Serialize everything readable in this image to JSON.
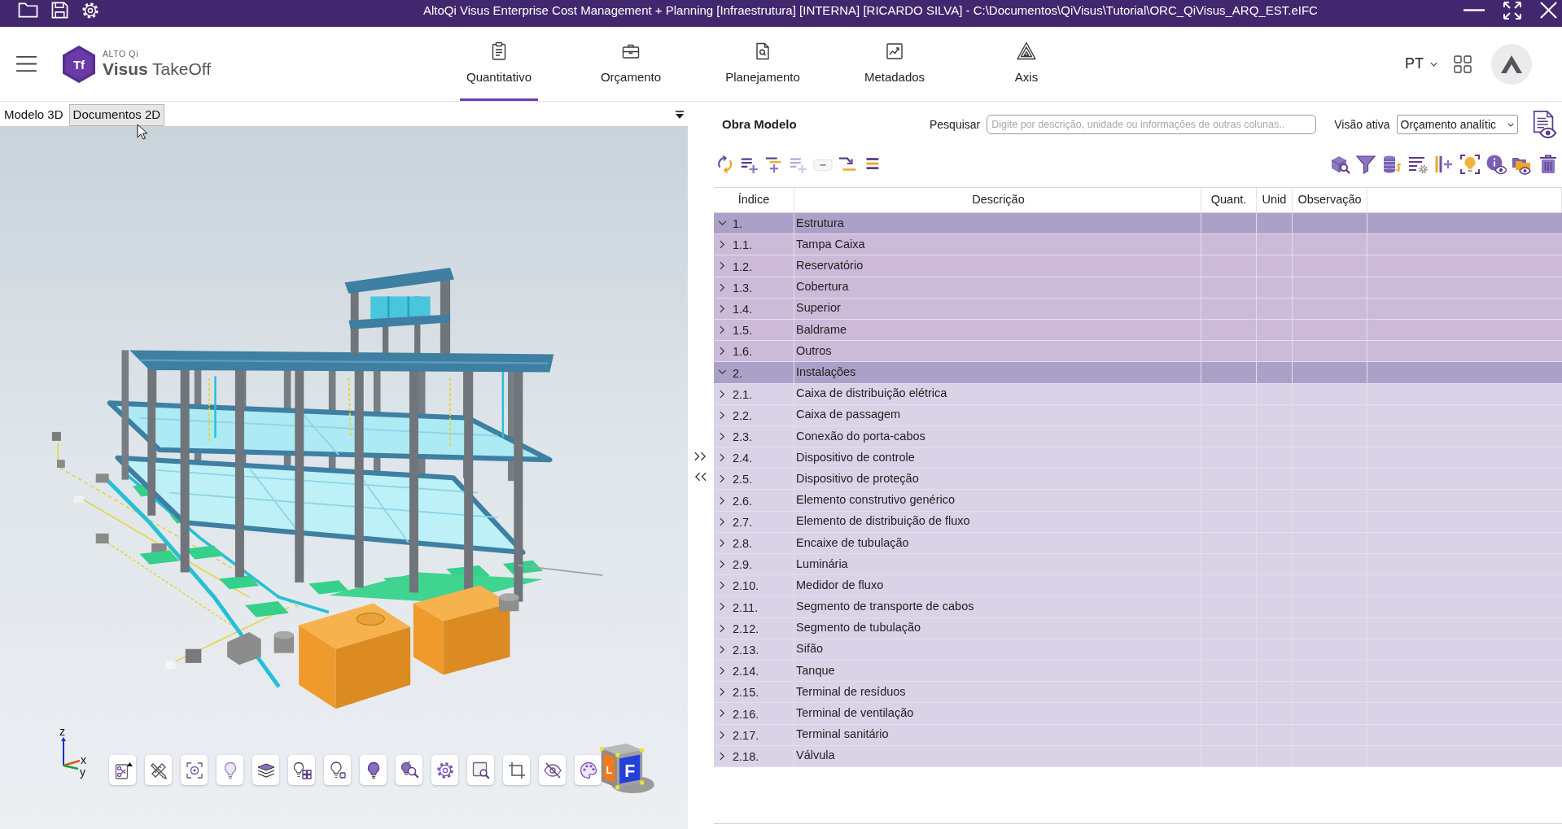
{
  "window": {
    "title": "AltoQi Visus Enterprise Cost Management + Planning [Infraestrutura] [INTERNA] [RICARDO SILVA] - C:\\Documentos\\QiVisus\\Tutorial\\ORC_QiVisus_ARQ_EST.eIFC"
  },
  "logo": {
    "mark": "Tf",
    "brand": "ALTO Qi",
    "product": "**Visus** TakeOff"
  },
  "nav_tabs": [
    {
      "label": "Quantitativo",
      "selected": true
    },
    {
      "label": "Orçamento",
      "selected": false
    },
    {
      "label": "Planejamento",
      "selected": false
    },
    {
      "label": "Metadados",
      "selected": false
    },
    {
      "label": "Axis",
      "selected": false
    }
  ],
  "language": "PT",
  "view_tabs": [
    {
      "label": "Modelo 3D",
      "selected": true
    },
    {
      "label": "Documentos 2D",
      "selected": false
    }
  ],
  "viewer": {
    "axis_labels": [
      "z",
      "x",
      "y"
    ],
    "view_cube": {
      "front": "F",
      "left": "L"
    }
  },
  "panel": {
    "title": "Obra Modelo",
    "search": {
      "label": "Pesquisar",
      "placeholder": "Digite por descrição, unidade ou informações de outras colunas.."
    },
    "view_select": {
      "label": "Visão ativa",
      "value": "Orçamento analític"
    }
  },
  "table": {
    "columns": [
      "Índice",
      "Descrição",
      "Quant.",
      "Unid",
      "Observação"
    ],
    "rows": [
      {
        "index": "1.",
        "description": "Estrutura",
        "expanded": true,
        "color": "#aba1c8",
        "children": [
          {
            "index": "1.1.",
            "description": "Tampa Caixa",
            "expanded": false,
            "color": "#cdb9d8"
          },
          {
            "index": "1.2.",
            "description": "Reservatório",
            "expanded": false,
            "color": "#cdb9d8"
          },
          {
            "index": "1.3.",
            "description": "Cobertura",
            "expanded": false,
            "color": "#cdb9d8"
          },
          {
            "index": "1.4.",
            "description": "Superior",
            "expanded": false,
            "color": "#cdb9d8"
          },
          {
            "index": "1.5.",
            "description": "Baldrame",
            "expanded": false,
            "color": "#cdb9d8"
          },
          {
            "index": "1.6.",
            "description": "Outros",
            "expanded": false,
            "color": "#cdb9d8"
          }
        ]
      },
      {
        "index": "2.",
        "description": "Instalações",
        "expanded": true,
        "color": "#aba1c8",
        "children": [
          {
            "index": "2.1.",
            "description": "Caixa de distribuição elétrica",
            "expanded": false,
            "color": "#d9d3e8"
          },
          {
            "index": "2.2.",
            "description": "Caixa de passagem",
            "expanded": false,
            "color": "#d9d3e8"
          },
          {
            "index": "2.3.",
            "description": "Conexão do porta-cabos",
            "expanded": false,
            "color": "#d9d3e8"
          },
          {
            "index": "2.4.",
            "description": "Dispositivo de controle",
            "expanded": false,
            "color": "#d9d3e8"
          },
          {
            "index": "2.5.",
            "description": "Dispositivo de proteção",
            "expanded": false,
            "color": "#d9d3e8"
          },
          {
            "index": "2.6.",
            "description": "Elemento construtivo genérico",
            "expanded": false,
            "color": "#d9d3e8"
          },
          {
            "index": "2.7.",
            "description": "Elemento de distribuição de fluxo",
            "expanded": false,
            "color": "#d9d3e8"
          },
          {
            "index": "2.8.",
            "description": "Encaixe de tubulação",
            "expanded": false,
            "color": "#d9d3e8"
          },
          {
            "index": "2.9.",
            "description": "Luminária",
            "expanded": false,
            "color": "#d9d3e8"
          },
          {
            "index": "2.10.",
            "description": "Medidor de fluxo",
            "expanded": false,
            "color": "#d9d3e8"
          },
          {
            "index": "2.11.",
            "description": "Segmento de transporte de cabos",
            "expanded": false,
            "color": "#d9d3e8"
          },
          {
            "index": "2.12.",
            "description": "Segmento de tubulação",
            "expanded": false,
            "color": "#d9d3e8"
          },
          {
            "index": "2.13.",
            "description": "Sifão",
            "expanded": false,
            "color": "#d9d3e8"
          },
          {
            "index": "2.14.",
            "description": "Tanque",
            "expanded": false,
            "color": "#d9d3e8"
          },
          {
            "index": "2.15.",
            "description": "Terminal de resíduos",
            "expanded": false,
            "color": "#d9d3e8"
          },
          {
            "index": "2.16.",
            "description": "Terminal de ventilação",
            "expanded": false,
            "color": "#d9d3e8"
          },
          {
            "index": "2.17.",
            "description": "Terminal sanitário",
            "expanded": false,
            "color": "#d9d3e8"
          },
          {
            "index": "2.18.",
            "description": "Válvula",
            "expanded": false,
            "color": "#d9d3e8"
          }
        ]
      }
    ]
  }
}
